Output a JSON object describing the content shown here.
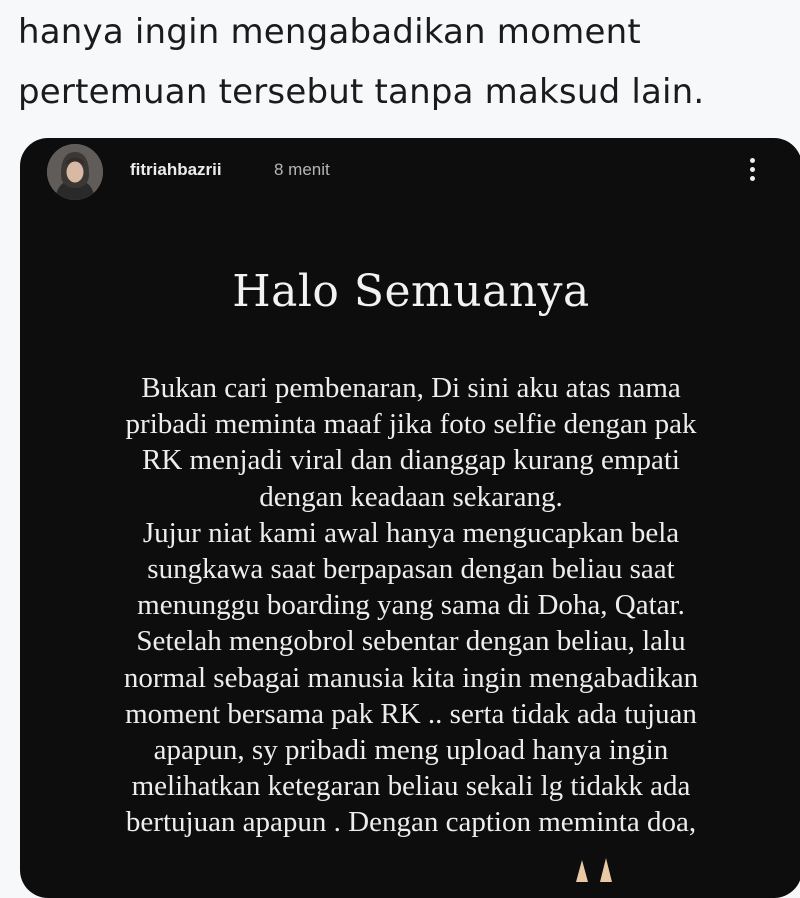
{
  "tweet": {
    "lines": [
      "hanya ingin mengabadikan moment",
      "pertemuan tersebut tanpa maksud lain."
    ]
  },
  "story": {
    "username": "fitriahbazrii",
    "time": "8 menit",
    "title": "Halo Semuanya",
    "body_lines": [
      "Bukan cari pembenaran, Di sini aku atas nama",
      "pribadi meminta maaf jika foto selfie dengan pak",
      "RK menjadi viral dan dianggap kurang empati",
      "dengan keadaan sekarang.",
      "Jujur niat kami awal hanya mengucapkan bela",
      "sungkawa saat berpapasan dengan beliau saat",
      "menunggu boarding yang sama di Doha, Qatar.",
      "Setelah mengobrol sebentar dengan beliau, lalu",
      "normal sebagai manusia kita ingin mengabadikan",
      "moment bersama pak RK .. serta tidak ada tujuan",
      "apapun, sy pribadi meng upload hanya ingin",
      "melihatkan ketegaran beliau sekali lg tidakk ada",
      "bertujuan apapun . Dengan caption meminta doa,"
    ],
    "icons": {
      "avatar": "profile-photo",
      "more": "more-vertical-icon",
      "emoji": "praying-hands-icon"
    }
  },
  "colors": {
    "page_bg": "#f7f8f9",
    "story_bg": "#0d0d0d",
    "story_text": "#ededed"
  }
}
